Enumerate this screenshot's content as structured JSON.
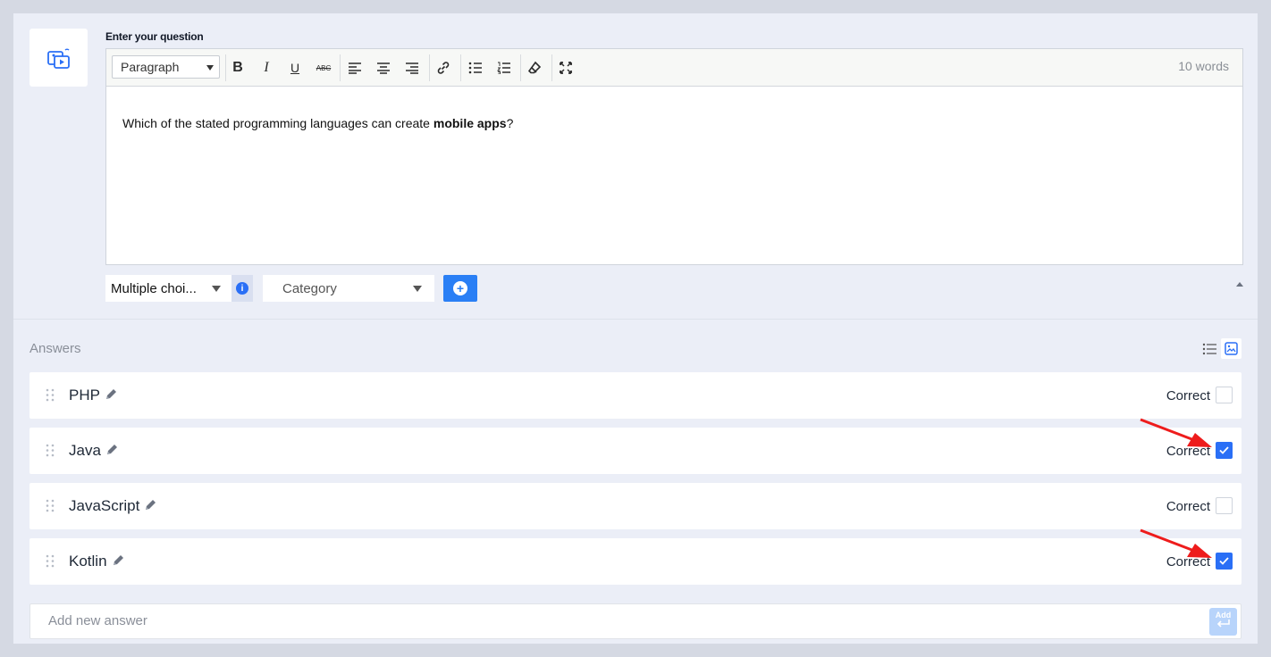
{
  "question": {
    "label": "Enter your question",
    "format_select": "Paragraph",
    "word_count": "10 words",
    "text_before": "Which of the stated programming languages can create ",
    "text_bold": "mobile apps",
    "text_after": "?"
  },
  "toolbar": {
    "bold_label": "B",
    "italic_label": "I",
    "underline_label": "U",
    "strike_label": "ABC"
  },
  "controls": {
    "question_type": "Multiple choi...",
    "info_label": "i",
    "category": "Category",
    "add_category_label": "+"
  },
  "answers": {
    "label": "Answers",
    "correct_label": "Correct",
    "items": [
      {
        "text": "PHP",
        "correct": false
      },
      {
        "text": "Java",
        "correct": true
      },
      {
        "text": "JavaScript",
        "correct": false
      },
      {
        "text": "Kotlin",
        "correct": true
      }
    ],
    "new_placeholder": "Add new answer",
    "add_label": "Add"
  },
  "colors": {
    "accent": "#2a6ff6",
    "annotation_arrow": "#ee1c1c"
  }
}
